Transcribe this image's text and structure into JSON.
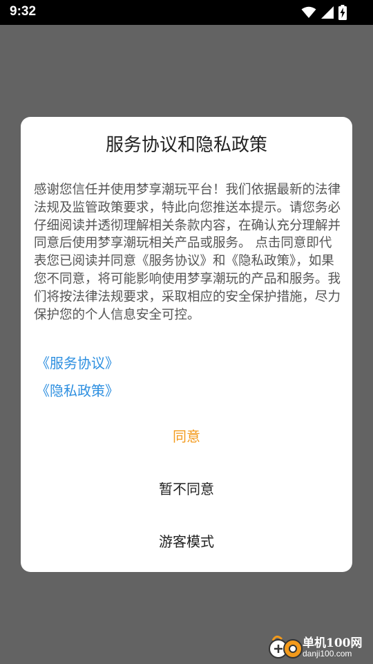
{
  "status_bar": {
    "time": "9:32",
    "icons": [
      "wifi-icon",
      "cell-signal-icon",
      "battery-charging-icon"
    ]
  },
  "dialog": {
    "title": "服务协议和隐私政策",
    "body": "感谢您信任并使用梦享潮玩平台！我们依据最新的法律法规及监管政策要求，特此向您推送本提示。请您务必仔细阅读并透彻理解相关条款内容，在确认充分理解并同意后使用梦享潮玩相关产品或服务。 点击同意即代表您已阅读并同意《服务协议》和《隐私政策》，如果您不同意，将可能影响使用梦享潮玩的产品和服务。我们将按法律法规要求，采取相应的安全保护措施，尽力保护您的个人信息安全可控。",
    "links": {
      "service_agreement": "《服务协议》",
      "privacy_policy": "《隐私政策》"
    },
    "buttons": {
      "agree": "同意",
      "disagree": "暂不同意",
      "guest_mode": "游客模式"
    }
  },
  "watermark": {
    "title": "单机100网",
    "url": "danji100.com"
  },
  "colors": {
    "backdrop": "#636363",
    "link": "#2d8fe0",
    "agree": "#f39a1b",
    "text": "#222222"
  }
}
